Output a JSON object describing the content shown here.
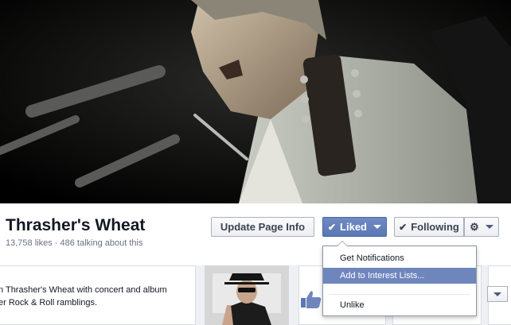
{
  "page": {
    "name": "Thrasher's Wheat",
    "stats": "13,758 likes · 486 talking about this"
  },
  "actions": {
    "update_label": "Update Page Info",
    "liked_label": "Liked",
    "following_label": "Following"
  },
  "liked_menu": {
    "items": [
      "Get Notifications",
      "Add to Interest Lists...",
      "Unlike"
    ],
    "highlighted": "Add to Interest Lists..."
  },
  "about": {
    "line1": "n Thrasher's Wheat with concert and album",
    "line2": "er Rock & Roll ramblings."
  },
  "colors": {
    "accent": "#5b77b4",
    "highlight": "#6f86bd"
  },
  "icons": {
    "check": "check-icon",
    "gear": "gear-icon",
    "caret": "chevron-down-icon",
    "like": "thumbs-up-icon"
  }
}
